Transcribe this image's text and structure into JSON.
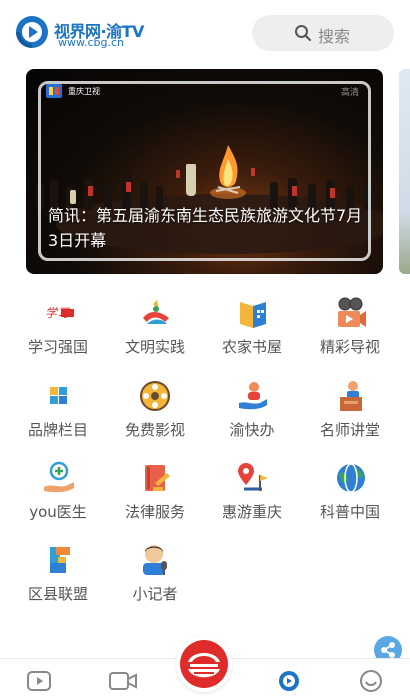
{
  "header": {
    "logo_title": "视界网·渝TV",
    "logo_url": "www.cbg.cn",
    "search_label": "搜索"
  },
  "banner": {
    "channel_name": "重庆卫视",
    "watermark": "高清",
    "caption": "简讯：第五届渝东南生态民族旅游文化节7月3日开幕"
  },
  "grid": [
    {
      "label": "学习强国",
      "icon": "xuexi-logo-icon"
    },
    {
      "label": "文明实践",
      "icon": "civilization-practice-icon"
    },
    {
      "label": "农家书屋",
      "icon": "book-house-icon"
    },
    {
      "label": "精彩导视",
      "icon": "video-camera-icon"
    },
    {
      "label": "品牌栏目",
      "icon": "brand-column-icon"
    },
    {
      "label": "免费影视",
      "icon": "film-reel-icon"
    },
    {
      "label": "渝快办",
      "icon": "service-hand-icon"
    },
    {
      "label": "名师讲堂",
      "icon": "lecturer-podium-icon"
    },
    {
      "label": "you医生",
      "icon": "doctor-hand-icon"
    },
    {
      "label": "法律服务",
      "icon": "law-book-gavel-icon"
    },
    {
      "label": "惠游重庆",
      "icon": "map-pin-flag-icon"
    },
    {
      "label": "科普中国",
      "icon": "science-globe-icon"
    },
    {
      "label": "区县联盟",
      "icon": "county-alliance-icon"
    },
    {
      "label": "小记者",
      "icon": "reporter-mic-icon"
    }
  ],
  "bottom_nav": [
    "play-icon",
    "video-camera-icon",
    "cbg-center-logo",
    "tv-play-icon",
    "smile-icon"
  ],
  "colors": {
    "brand_blue": "#1b74c5",
    "accent_red": "#e02b2b",
    "label_gray": "#555555"
  }
}
